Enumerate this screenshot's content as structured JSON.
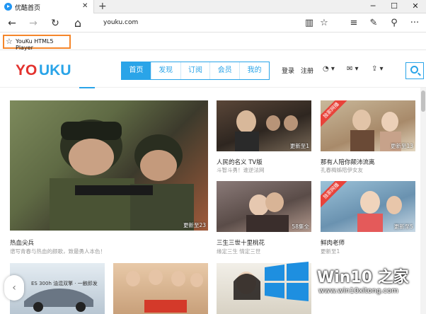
{
  "browser": {
    "tab_title": "优酷首页",
    "tab_close": "✕",
    "new_tab": "+",
    "window_controls": [
      "─",
      "☐",
      "✕"
    ],
    "address": "youku.com",
    "favorite_label": "YouKu HTML5 Player",
    "icons": {
      "back": "←",
      "forward": "→",
      "refresh": "↻",
      "home": "⌂",
      "reading_view": "▥",
      "favorite": "☆",
      "hub": "≡",
      "notes": "✎",
      "share": "⚲",
      "more": "···"
    }
  },
  "youku": {
    "logo": "YOUKU",
    "nav": [
      "首页",
      "发现",
      "订阅",
      "会员",
      "我的"
    ],
    "login": "登录",
    "register": "注册"
  },
  "videos": {
    "featured": {
      "title": "热血尖兵",
      "subtitle": "谱写青春与热血的颜歌，致最勇人本色！",
      "badge": "更新至23"
    },
    "v1": {
      "title": "人民的名义 TV版",
      "subtitle": "斗智斗勇！谁逆法网",
      "badge": "更新至1"
    },
    "v2": {
      "title": "那有人陪你颠沛流离",
      "subtitle": "孔春梅姊陪伊女友",
      "badge": "更新至13",
      "ribbon": "独家网播"
    },
    "v3": {
      "title": "三生三世十里桃花",
      "subtitle": "缘定三生 情定三世",
      "badge": "58集全"
    },
    "v4": {
      "title": "鲜肉老师",
      "subtitle": "更新至1",
      "badge": "更新至5",
      "ribbon": "独家网播"
    },
    "car_banner_text": "ES 300h 油混双擎 · 一触即发"
  },
  "watermark": {
    "title": "Win10 之家",
    "url": "www.win10xitong.com"
  },
  "colors": {
    "youku_blue": "#2aa4e8",
    "youku_red": "#e3322e",
    "favorite_highlight": "#f5862a",
    "ribbon_red": "#e8433a"
  }
}
